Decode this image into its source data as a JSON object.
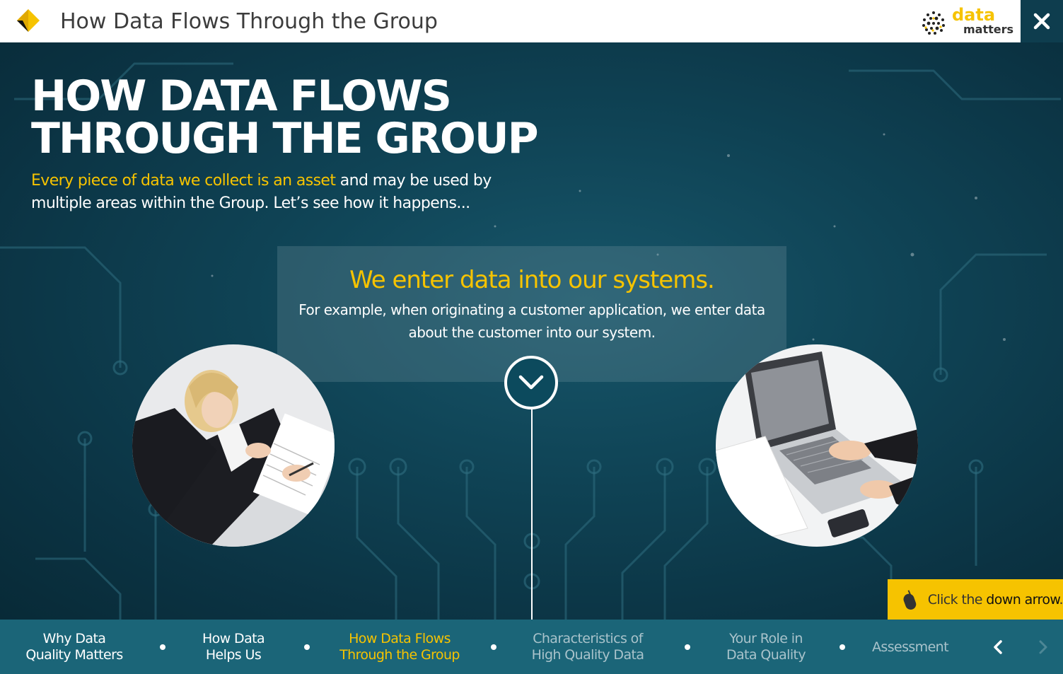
{
  "header": {
    "title": "How Data Flows Through the Group",
    "brand_word1": "data",
    "brand_word2": "matters",
    "close_icon": "close-icon",
    "help_icon": "help-icon"
  },
  "main": {
    "heading_line1": "HOW DATA FLOWS",
    "heading_line2": "THROUGH THE GROUP",
    "intro_highlight": "Every piece of data we collect is an asset",
    "intro_rest": " and may be used by multiple areas within the Group. Let’s see how it happens...",
    "info_title": "We enter data into our systems.",
    "info_body": "For example, when originating a customer application, we enter data about the customer into our system.",
    "down_icon": "chevron-down-icon",
    "hint_prefix": "Click the ",
    "hint_emph": "down arrow",
    "hint_suffix": "."
  },
  "nav": {
    "items": [
      {
        "line1": "Why Data",
        "line2": "Quality Matters"
      },
      {
        "line1": "How Data",
        "line2": "Helps Us"
      },
      {
        "line1": "How Data Flows",
        "line2": "Through the Group"
      },
      {
        "line1": "Characteristics of",
        "line2": "High Quality Data"
      },
      {
        "line1": "Your Role in",
        "line2": "Data Quality"
      },
      {
        "line1": "Assessment",
        "line2": ""
      }
    ],
    "active_index": 2
  },
  "colors": {
    "accent": "#f6c300",
    "nav_bg": "#1b6578",
    "main_bg": "#0f4355",
    "close_bg": "#0e3d4e",
    "help_bg": "#4f5155"
  }
}
